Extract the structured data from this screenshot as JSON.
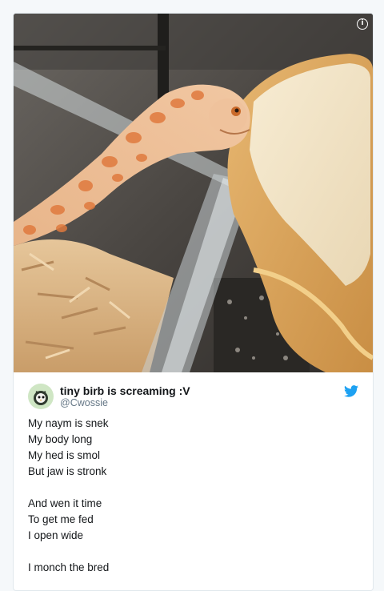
{
  "tweet": {
    "display_name": "tiny birb is screaming :V",
    "handle": "@Cwossie",
    "lines": [
      "My naym is snek",
      "My body long",
      "My hed is smol",
      "But jaw is stronk",
      "",
      "And wen it time",
      "To get me fed",
      "I open wide",
      "",
      "I monch the bred"
    ]
  },
  "media": {
    "description_icon": "info-icon"
  },
  "icons": {
    "platform": "twitter-bird-icon",
    "info": "info-icon"
  },
  "colors": {
    "accent": "#1da1f2",
    "text": "#14171a",
    "muted": "#657786"
  }
}
